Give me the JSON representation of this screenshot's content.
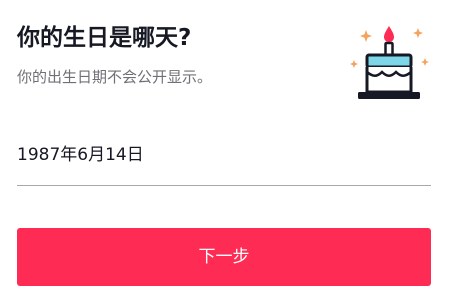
{
  "header": {
    "title": "你的生日是哪天?",
    "subtitle": "你的出生日期不会公开显示。"
  },
  "birthday_field": {
    "value": "1987年6月14日"
  },
  "next_button": {
    "label": "下一步"
  },
  "illustration": {
    "icon": "birthday-cake-icon"
  },
  "colors": {
    "accent": "#fe2c55",
    "text_primary": "#161823",
    "text_secondary": "#6f7077",
    "divider": "#a8a9ad",
    "cake_frosting": "#7dd6e8",
    "candle_flame": "#fe2c55",
    "sparkle": "#f4a25c"
  }
}
